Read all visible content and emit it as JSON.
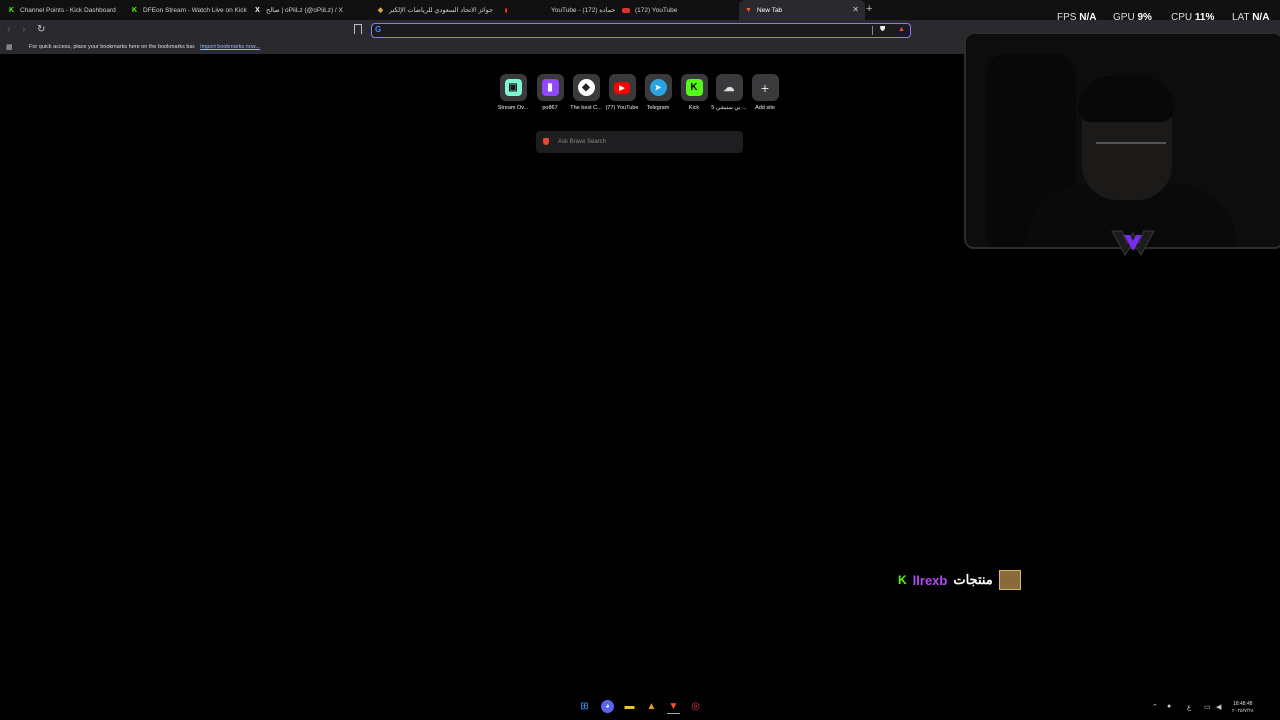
{
  "tabs": [
    {
      "label": "Channel Points - Kick Dashboard",
      "icon": "kick-icon",
      "active": false
    },
    {
      "label": "DFEon Stream - Watch Live on Kick",
      "icon": "kick-icon",
      "active": false
    },
    {
      "label": "صالح | oPiiLz (@oPiiLz) / X",
      "icon": "x-icon",
      "active": false
    },
    {
      "label": "جوائز الاتحاد السعودي للرياضات الإلكتر",
      "icon": "award-icon",
      "active": false
    },
    {
      "label": "YouTube - حماده (172)",
      "icon": "youtube-icon",
      "active": false
    },
    {
      "label": "(172) YouTube",
      "icon": "youtube-icon",
      "active": false
    },
    {
      "label": "New Tab",
      "icon": "brave-icon",
      "active": true
    }
  ],
  "bookmarks_bar": {
    "text": "For quick access, place your bookmarks here on the bookmarks bar.",
    "link": "Import bookmarks now..."
  },
  "omnibox": {
    "value": "",
    "placeholder": ""
  },
  "shortcuts": [
    {
      "label": "Stream Ov...",
      "icon": "streamlabs-icon",
      "color": "#80f5d2"
    },
    {
      "label": "po867",
      "icon": "twitch-icon",
      "color": "#9146ff"
    },
    {
      "label": "The best C...",
      "icon": "shield-icon",
      "color": "#ffffff"
    },
    {
      "label": "(77) YouTube",
      "icon": "youtube-icon",
      "color": "#ff0000"
    },
    {
      "label": "Telegram",
      "icon": "telegram-icon",
      "color": "#2aa3e0"
    },
    {
      "label": "Kick",
      "icon": "kick-icon",
      "color": "#53fc18"
    },
    {
      "label": "بي ستيشن 5 ...",
      "icon": "cloud-icon",
      "color": "#dddddd"
    },
    {
      "label": "Add site",
      "icon": "plus-icon",
      "color": "#dddddd"
    }
  ],
  "search": {
    "placeholder": "Ask Brave Search"
  },
  "hud": {
    "fps_label": "FPS",
    "fps_value": "N/A",
    "gpu_label": "GPU",
    "gpu_value": "9%",
    "cpu_label": "CPU",
    "cpu_value": "11%",
    "lat_label": "LAT",
    "lat_value": "N/A"
  },
  "overlay": {
    "platform": "K",
    "name": "llrexb",
    "arabic": "منتجات"
  },
  "clock": {
    "time": "18:48:48",
    "date": "٢٠٢٥/٧/٢٨"
  },
  "tray": {
    "lang": "ع"
  }
}
